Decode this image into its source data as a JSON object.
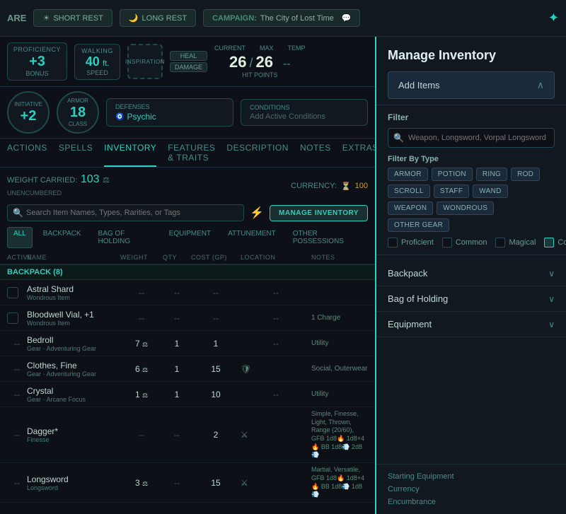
{
  "topbar": {
    "title": "ARE",
    "short_rest": "SHORT REST",
    "long_rest": "LONG REST",
    "campaign_label": "CAMPAIGN:",
    "campaign_name": "The City of Lost Time",
    "star": "✦"
  },
  "stats": {
    "proficiency": {
      "label": "PROFICIENCY",
      "sub": "BONUS",
      "value": "+3"
    },
    "walking": {
      "label": "WALKING",
      "sub": "SPEED",
      "value": "40",
      "unit": "ft."
    },
    "inspiration": {
      "label": "INSPIRATION"
    },
    "heal_label": "HEAL",
    "damage_label": "DAMAGE",
    "hp_current": "26",
    "hp_max": "26",
    "hp_temp": "--",
    "hp_label": "HIT POINTS",
    "current_label": "CURRENT",
    "max_label": "MAX",
    "temp_label": "TEMP"
  },
  "stats2": {
    "initiative_label": "INITIATIVE",
    "initiative_value": "+2",
    "armor_label": "ARMOR",
    "armor_class": "CLASS",
    "armor_value": "18",
    "defenses_label": "DEFENSES",
    "defenses_value": "Psychic",
    "conditions_label": "CONDITIONS",
    "conditions_value": "Add Active Conditions"
  },
  "nav": {
    "tabs": [
      "ACTIONS",
      "SPELLS",
      "INVENTORY",
      "FEATURES & TRAITS",
      "DESCRIPTION",
      "NOTES",
      "EXTRAS"
    ],
    "active": "INVENTORY"
  },
  "inventory": {
    "weight_label": "WEIGHT CARRIED:",
    "weight_value": "103",
    "unencumbered": "UNENCUMBERED",
    "currency_label": "CURRENCY:",
    "currency_value": "100",
    "search_placeholder": "Search Item Names, Types, Rarities, or Tags",
    "manage_btn": "MANAGE INVENTORY",
    "bag_tabs": [
      "ALL",
      "BACKPACK",
      "BAG OF HOLDING",
      "EQUIPMENT",
      "ATTUNEMENT",
      "OTHER POSSESSIONS"
    ],
    "active_bag_tab": "ALL",
    "columns": [
      "ACTIVE",
      "NAME",
      "WEIGHT",
      "QTY",
      "COST (GP)",
      "LOCATION",
      "NOTES"
    ],
    "backpack_section": "BACKPACK (8)",
    "items": [
      {
        "name": "Astral Shard",
        "type": "Wondrous Item",
        "weight": "--",
        "qty": "--",
        "cost": "--",
        "location": "--",
        "notes": "",
        "checked": false
      },
      {
        "name": "Bloodwell Vial, +1",
        "type": "Wondrous Item",
        "weight": "--",
        "qty": "--",
        "cost": "--",
        "location": "--",
        "notes": "1 Charge",
        "checked": false
      },
      {
        "name": "Bedroll",
        "type": "Gear · Adventuring Gear",
        "weight": "7",
        "qty": "1",
        "cost": "1",
        "location": "--",
        "notes": "Utility",
        "active": "--"
      },
      {
        "name": "Clothes, Fine",
        "type": "Gear · Adventuring Gear",
        "weight": "6",
        "qty": "1",
        "cost": "15",
        "location": "🛡",
        "notes": "Social, Outerwear",
        "active": "--"
      },
      {
        "name": "Crystal",
        "type": "Gear · Arcane Focus",
        "weight": "1",
        "qty": "1",
        "cost": "10",
        "location": "--",
        "notes": "Utility",
        "active": "--"
      },
      {
        "name": "Dagger*",
        "type": "Finesse",
        "weight": "--",
        "qty": "--",
        "cost": "2",
        "location": "⚔",
        "notes": "Simple, Finesse, Light, Thrown, Range (20/60), Green Flame Blade 1d8 🔥 1d8+4 🔥 Booming Blade 1d8 💨 2d8 💨",
        "active": "--"
      },
      {
        "name": "Longsword",
        "type": "Longsword",
        "weight": "3",
        "qty": "--",
        "cost": "15",
        "location": "⚔",
        "notes": "Martial, Versatile, Green-Flame Blade 1d8 🔥 1d8+4 🔥 Booming Blade 1d8 💨 1d8 💨",
        "active": "--"
      }
    ]
  },
  "manage_inventory": {
    "title": "Manage Inventory",
    "add_items_label": "Add Items",
    "filter_title": "Filter",
    "filter_placeholder": "Weapon, Longsword, Vorpal Longsword, etc.",
    "filter_by_type_title": "Filter By Type",
    "type_chips": [
      "ARMOR",
      "POTION",
      "RING",
      "ROD",
      "SCROLL",
      "STAFF",
      "WAND",
      "WEAPON",
      "WONDROUS",
      "OTHER GEAR"
    ],
    "checkboxes": [
      {
        "label": "Proficient",
        "checked": false
      },
      {
        "label": "Common",
        "checked": false
      },
      {
        "label": "Magical",
        "checked": false
      },
      {
        "label": "Container",
        "checked": true
      }
    ],
    "sections": [
      {
        "name": "Backpack"
      },
      {
        "name": "Bag of Holding"
      },
      {
        "name": "Equipment"
      }
    ],
    "extra_links": [
      "Starting Equipment",
      "Currency",
      "Encumbrance"
    ]
  }
}
